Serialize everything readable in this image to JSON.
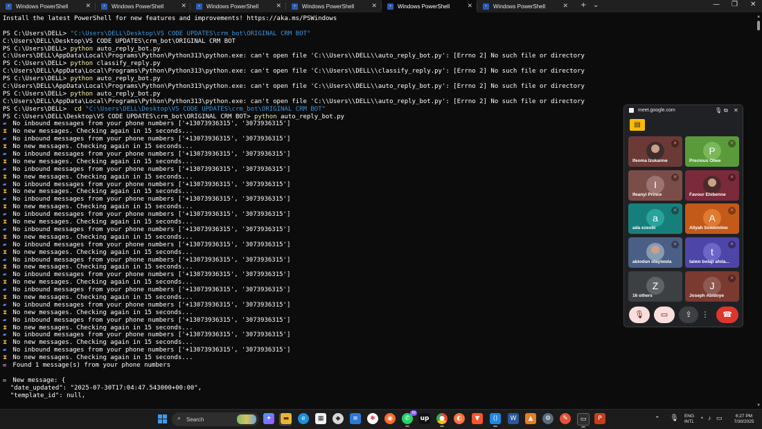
{
  "tabs": [
    {
      "title": "Windows PowerShell",
      "active": false
    },
    {
      "title": "Windows PowerShell",
      "active": false
    },
    {
      "title": "Windows PowerShell",
      "active": false
    },
    {
      "title": "Windows PowerShell",
      "active": false
    },
    {
      "title": "Windows PowerShell",
      "active": true
    },
    {
      "title": "Windows PowerShell",
      "active": false
    }
  ],
  "tabbar": {
    "new_tab": "+",
    "dropdown": "⌄",
    "minimize": "—",
    "maximize": "❐",
    "close": "✕"
  },
  "terminal": {
    "lines": [
      {
        "parts": [
          {
            "t": "Install the latest PowerShell for new features and improvements! https://aka.ms/PSWindows",
            "c": "w"
          }
        ]
      },
      {
        "parts": []
      },
      {
        "parts": [
          {
            "t": "PS C:\\Users\\DELL> ",
            "c": "w"
          },
          {
            "t": "\"C:\\Users\\DELL\\Desktop\\VS CODE UPDATES\\crm_bot\\ORIGINAL CRM BOT\"",
            "c": "c"
          }
        ]
      },
      {
        "parts": [
          {
            "t": "C:\\Users\\DELL\\Desktop\\VS CODE UPDATES\\crm_bot\\ORIGINAL CRM BOT",
            "c": "w"
          }
        ]
      },
      {
        "parts": [
          {
            "t": "PS C:\\Users\\DELL> ",
            "c": "w"
          },
          {
            "t": "python",
            "c": "y"
          },
          {
            "t": " auto_reply_bot.py",
            "c": "w"
          }
        ]
      },
      {
        "parts": [
          {
            "t": "C:\\Users\\DELL\\AppData\\Local\\Programs\\Python\\Python313\\python.exe: can't open file 'C:\\\\Users\\\\DELL\\\\auto_reply_bot.py': [Errno 2] No such file or directory",
            "c": "w"
          }
        ]
      },
      {
        "parts": [
          {
            "t": "PS C:\\Users\\DELL> ",
            "c": "w"
          },
          {
            "t": "python",
            "c": "y"
          },
          {
            "t": " classify_reply.py",
            "c": "w"
          }
        ]
      },
      {
        "parts": [
          {
            "t": "C:\\Users\\DELL\\AppData\\Local\\Programs\\Python\\Python313\\python.exe: can't open file 'C:\\\\Users\\\\DELL\\\\classify_reply.py': [Errno 2] No such file or directory",
            "c": "w"
          }
        ]
      },
      {
        "parts": [
          {
            "t": "PS C:\\Users\\DELL> ",
            "c": "w"
          },
          {
            "t": "python",
            "c": "y"
          },
          {
            "t": " auto_reply_bot.py",
            "c": "w"
          }
        ]
      },
      {
        "parts": [
          {
            "t": "C:\\Users\\DELL\\AppData\\Local\\Programs\\Python\\Python313\\python.exe: can't open file 'C:\\\\Users\\\\DELL\\\\auto_reply_bot.py': [Errno 2] No such file or directory",
            "c": "w"
          }
        ]
      },
      {
        "parts": [
          {
            "t": "PS C:\\Users\\DELL> ",
            "c": "w"
          },
          {
            "t": "python",
            "c": "y"
          },
          {
            "t": " auto_reply_bot.py",
            "c": "w"
          }
        ]
      },
      {
        "parts": [
          {
            "t": "C:\\Users\\DELL\\AppData\\Local\\Programs\\Python\\Python313\\python.exe: can't open file 'C:\\\\Users\\\\DELL\\\\auto_reply_bot.py': [Errno 2] No such file or directory",
            "c": "w"
          }
        ]
      },
      {
        "parts": [
          {
            "t": "PS C:\\Users\\DELL> ",
            "c": "w"
          },
          {
            "t": " cd ",
            "c": "y"
          },
          {
            "t": "\"C:\\Users\\DELL\\Desktop\\VS CODE UPDATES\\crm_bot\\ORIGINAL CRM BOT\"",
            "c": "c"
          }
        ]
      },
      {
        "parts": [
          {
            "t": "PS C:\\Users\\DELL\\Desktop\\VS CODE UPDATES\\crm_bot\\ORIGINAL CRM BOT> ",
            "c": "w"
          },
          {
            "t": "python",
            "c": "y"
          },
          {
            "t": " auto_reply_bot.py",
            "c": "w"
          }
        ]
      },
      {
        "icon": "inbox",
        "parts": [
          {
            "t": " No inbound messages from your phone numbers ['+13073936315', '3073936315']",
            "c": "w"
          }
        ]
      },
      {
        "icon": "hourglass",
        "parts": [
          {
            "t": " No new messages. Checking again in 15 seconds...",
            "c": "w"
          }
        ]
      },
      {
        "icon": "inbox",
        "parts": [
          {
            "t": " No inbound messages from your phone numbers ['+13073936315', '3073936315']",
            "c": "w"
          }
        ]
      },
      {
        "icon": "hourglass",
        "parts": [
          {
            "t": " No new messages. Checking again in 15 seconds...",
            "c": "w"
          }
        ]
      },
      {
        "icon": "inbox",
        "parts": [
          {
            "t": " No inbound messages from your phone numbers ['+13073936315', '3073936315']",
            "c": "w"
          }
        ]
      },
      {
        "icon": "hourglass",
        "parts": [
          {
            "t": " No new messages. Checking again in 15 seconds...",
            "c": "w"
          }
        ]
      },
      {
        "icon": "inbox",
        "parts": [
          {
            "t": " No inbound messages from your phone numbers ['+13073936315', '3073936315']",
            "c": "w"
          }
        ]
      },
      {
        "icon": "hourglass",
        "parts": [
          {
            "t": " No new messages. Checking again in 15 seconds...",
            "c": "w"
          }
        ]
      },
      {
        "icon": "inbox",
        "parts": [
          {
            "t": " No inbound messages from your phone numbers ['+13073936315', '3073936315']",
            "c": "w"
          }
        ]
      },
      {
        "icon": "hourglass",
        "parts": [
          {
            "t": " No new messages. Checking again in 15 seconds...",
            "c": "w"
          }
        ]
      },
      {
        "icon": "inbox",
        "parts": [
          {
            "t": " No inbound messages from your phone numbers ['+13073936315', '3073936315']",
            "c": "w"
          }
        ]
      },
      {
        "icon": "hourglass",
        "parts": [
          {
            "t": " No new messages. Checking again in 15 seconds...",
            "c": "w"
          }
        ]
      },
      {
        "icon": "inbox",
        "parts": [
          {
            "t": " No inbound messages from your phone numbers ['+13073936315', '3073936315']",
            "c": "w"
          }
        ]
      },
      {
        "icon": "hourglass",
        "parts": [
          {
            "t": " No new messages. Checking again in 15 seconds...",
            "c": "w"
          }
        ]
      },
      {
        "icon": "inbox",
        "parts": [
          {
            "t": " No inbound messages from your phone numbers ['+13073936315', '3073936315']",
            "c": "w"
          }
        ]
      },
      {
        "icon": "hourglass",
        "parts": [
          {
            "t": " No new messages. Checking again in 15 seconds...",
            "c": "w"
          }
        ]
      },
      {
        "icon": "inbox",
        "parts": [
          {
            "t": " No inbound messages from your phone numbers ['+13073936315', '3073936315']",
            "c": "w"
          }
        ]
      },
      {
        "icon": "hourglass",
        "parts": [
          {
            "t": " No new messages. Checking again in 15 seconds...",
            "c": "w"
          }
        ]
      },
      {
        "icon": "inbox",
        "parts": [
          {
            "t": " No inbound messages from your phone numbers ['+13073936315', '3073936315']",
            "c": "w"
          }
        ]
      },
      {
        "icon": "hourglass",
        "parts": [
          {
            "t": " No new messages. Checking again in 15 seconds...",
            "c": "w"
          }
        ]
      },
      {
        "icon": "inbox",
        "parts": [
          {
            "t": " No inbound messages from your phone numbers ['+13073936315', '3073936315']",
            "c": "w"
          }
        ]
      },
      {
        "icon": "hourglass",
        "parts": [
          {
            "t": " No new messages. Checking again in 15 seconds...",
            "c": "w"
          }
        ]
      },
      {
        "icon": "inbox",
        "parts": [
          {
            "t": " No inbound messages from your phone numbers ['+13073936315', '3073936315']",
            "c": "w"
          }
        ]
      },
      {
        "icon": "hourglass",
        "parts": [
          {
            "t": " No new messages. Checking again in 15 seconds...",
            "c": "w"
          }
        ]
      },
      {
        "icon": "inbox",
        "parts": [
          {
            "t": " No inbound messages from your phone numbers ['+13073936315', '3073936315']",
            "c": "w"
          }
        ]
      },
      {
        "icon": "hourglass",
        "parts": [
          {
            "t": " No new messages. Checking again in 15 seconds...",
            "c": "w"
          }
        ]
      },
      {
        "icon": "inbox",
        "parts": [
          {
            "t": " No inbound messages from your phone numbers ['+13073936315', '3073936315']",
            "c": "w"
          }
        ]
      },
      {
        "icon": "hourglass",
        "parts": [
          {
            "t": " No new messages. Checking again in 15 seconds...",
            "c": "w"
          }
        ]
      },
      {
        "icon": "inbox",
        "parts": [
          {
            "t": " No inbound messages from your phone numbers ['+13073936315', '3073936315']",
            "c": "w"
          }
        ]
      },
      {
        "icon": "hourglass",
        "parts": [
          {
            "t": " No new messages. Checking again in 15 seconds...",
            "c": "w"
          }
        ]
      },
      {
        "icon": "inbox",
        "parts": [
          {
            "t": " No inbound messages from your phone numbers ['+13073936315', '3073936315']",
            "c": "w"
          }
        ]
      },
      {
        "icon": "hourglass",
        "parts": [
          {
            "t": " No new messages. Checking again in 15 seconds...",
            "c": "w"
          }
        ]
      },
      {
        "icon": "mail",
        "parts": [
          {
            "t": " Found 1 message(s) from your phone numbers",
            "c": "w"
          }
        ]
      },
      {
        "parts": []
      },
      {
        "icon": "mail",
        "parts": [
          {
            "t": " New message: {",
            "c": "w"
          }
        ]
      },
      {
        "parts": [
          {
            "t": "  \"date_updated\": \"2025-07-30T17:04:47.543000+00:00\",",
            "c": "w"
          }
        ]
      },
      {
        "parts": [
          {
            "t": "  \"template_id\": null,",
            "c": "w"
          }
        ]
      }
    ]
  },
  "meet": {
    "url": "meet.google.com",
    "participants": [
      {
        "name": "Ifeoma Izukanne",
        "initial": "",
        "bg": "#6b3a36",
        "avatar": "#3d2c2c",
        "muted": true,
        "photo": true
      },
      {
        "name": "Precious Obee",
        "initial": "P",
        "bg": "#5a9a3a",
        "avatar": "#79b85a",
        "muted": true,
        "photo": false
      },
      {
        "name": "Ifeanyi Prince",
        "initial": "I",
        "bg": "#7a4d49",
        "avatar": "#9c7470",
        "muted": true,
        "photo": false
      },
      {
        "name": "Favour Ehibenne",
        "initial": "",
        "bg": "#7a2a3a",
        "avatar": "#4a2a2a",
        "muted": true,
        "photo": true
      },
      {
        "name": "ada ezeobi",
        "initial": "a",
        "bg": "#177f7b",
        "avatar": "#2aa39e",
        "muted": true,
        "photo": false
      },
      {
        "name": "Aliyah Sowemimo",
        "initial": "A",
        "bg": "#c35a1a",
        "avatar": "#e07a30",
        "muted": true,
        "photo": false
      },
      {
        "name": "abiodun olayiwola",
        "initial": "",
        "bg": "#4a5f86",
        "avatar": "#8a9ab0",
        "muted": true,
        "photo": true
      },
      {
        "name": "taiwo bolaji afola...",
        "initial": "t",
        "bg": "#4e45a8",
        "avatar": "#6d66c8",
        "muted": true,
        "photo": false
      },
      {
        "name": "16 others",
        "initial": "Z",
        "bg": "#3c4043",
        "avatar": "#5f6368",
        "muted": false,
        "photo": false
      },
      {
        "name": "Joseph Abidoye",
        "initial": "J",
        "bg": "#7a3a30",
        "avatar": "#8c5a50",
        "muted": true,
        "photo": false
      }
    ],
    "controls": {
      "mic": "mic-off",
      "camera": "camera-off",
      "present": "present",
      "more": "more",
      "hangup": "hang-up"
    }
  },
  "taskbar": {
    "search_label": "Search",
    "language_top": "ENG",
    "language_bottom": "INTL",
    "time": "6:27 PM",
    "date": "7/30/2025",
    "whatsapp_badge": "39"
  }
}
